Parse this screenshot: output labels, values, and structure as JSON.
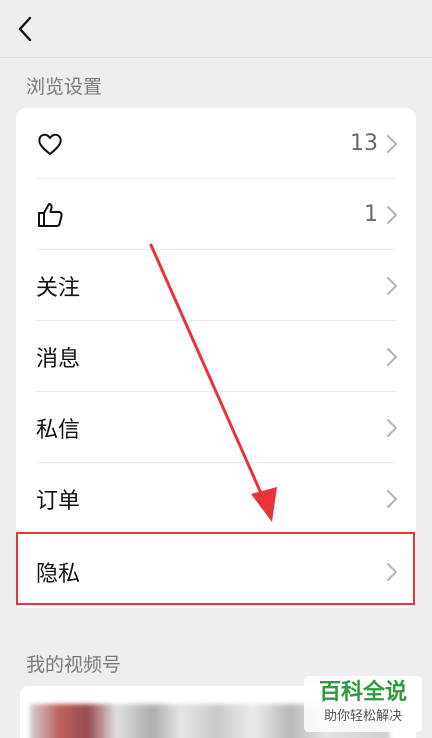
{
  "section_browse": {
    "title": "浏览设置"
  },
  "rows": [
    {
      "icon": "heart-icon",
      "count": "13"
    },
    {
      "icon": "thumbs-up-icon",
      "count": "1"
    },
    {
      "label": "关注"
    },
    {
      "label": "消息"
    },
    {
      "label": "私信"
    },
    {
      "label": "订单"
    },
    {
      "label": "隐私"
    }
  ],
  "section_channel": {
    "title": "我的视频号"
  },
  "watermark": {
    "title": "百科全说",
    "subtitle": "助你轻松解决"
  },
  "colors": {
    "annotation": "#e8333b",
    "watermark": "#2f9a3e"
  }
}
